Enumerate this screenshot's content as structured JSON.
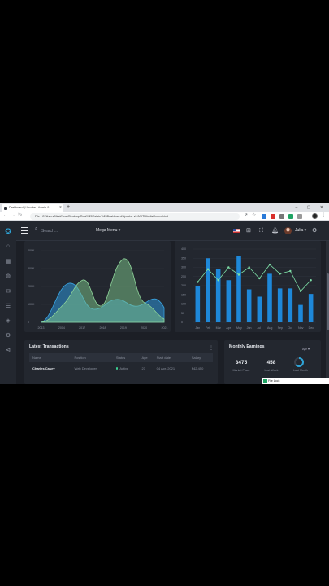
{
  "browser": {
    "tab_title": "Dashboard | Upcube - Admin &",
    "url": "File  |  C:/Users/Mad/Neat/Desktop/Real%20Estate%20Dashboard/Upcube v2.0/HTML/dist/index.html",
    "new_tab": "+",
    "window_controls": "– ▢ ✕"
  },
  "topbar": {
    "search_placeholder": "Search...",
    "mega_menu": "Mega Menu ▾",
    "user_name": "Julia ▾"
  },
  "area_chart": {
    "years": [
      "2013",
      "2014",
      "2017",
      "2018",
      "2019",
      "2020",
      "2021"
    ],
    "y_ticks": [
      "400K",
      "300K",
      "200K",
      "100K",
      "0"
    ]
  },
  "bar_chart": {
    "months": [
      "Jan",
      "Feb",
      "Mar",
      "Apr",
      "May",
      "Jun",
      "Jul",
      "Aug",
      "Sep",
      "Oct",
      "Nov",
      "Dec"
    ],
    "y_ticks": [
      "400",
      "350",
      "300",
      "250",
      "200",
      "150",
      "100",
      "50",
      "0"
    ],
    "bars": [
      200,
      350,
      290,
      230,
      360,
      180,
      140,
      265,
      185,
      185,
      95,
      155
    ],
    "line": [
      220,
      290,
      230,
      300,
      260,
      300,
      240,
      315,
      265,
      280,
      170,
      230
    ],
    "bar_color": "#1e88d9",
    "line_color": "#7ee0a8"
  },
  "transactions": {
    "title": "Latest Transactions",
    "headers": [
      "Name",
      "Position",
      "Status",
      "Age",
      "Start date",
      "Salary"
    ],
    "rows": [
      {
        "name": "Charles Casey",
        "position": "Web Developer",
        "status": "Active",
        "age": "23",
        "start": "04 Apr, 2021",
        "salary": "$42,450"
      }
    ]
  },
  "earnings": {
    "title": "Monthly Earnings",
    "period": "Apr ▾",
    "stats": [
      {
        "value": "3475",
        "label": "Market Place"
      },
      {
        "value": "458",
        "label": "Last Week"
      }
    ],
    "third_label": "Last Month"
  },
  "toast": "File Lock",
  "icons": [
    "logo-icon",
    "dashboard-icon",
    "calendar-icon",
    "chat-icon",
    "email-icon",
    "tasks-icon",
    "layouts-icon",
    "settings-icon",
    "share-icon"
  ]
}
